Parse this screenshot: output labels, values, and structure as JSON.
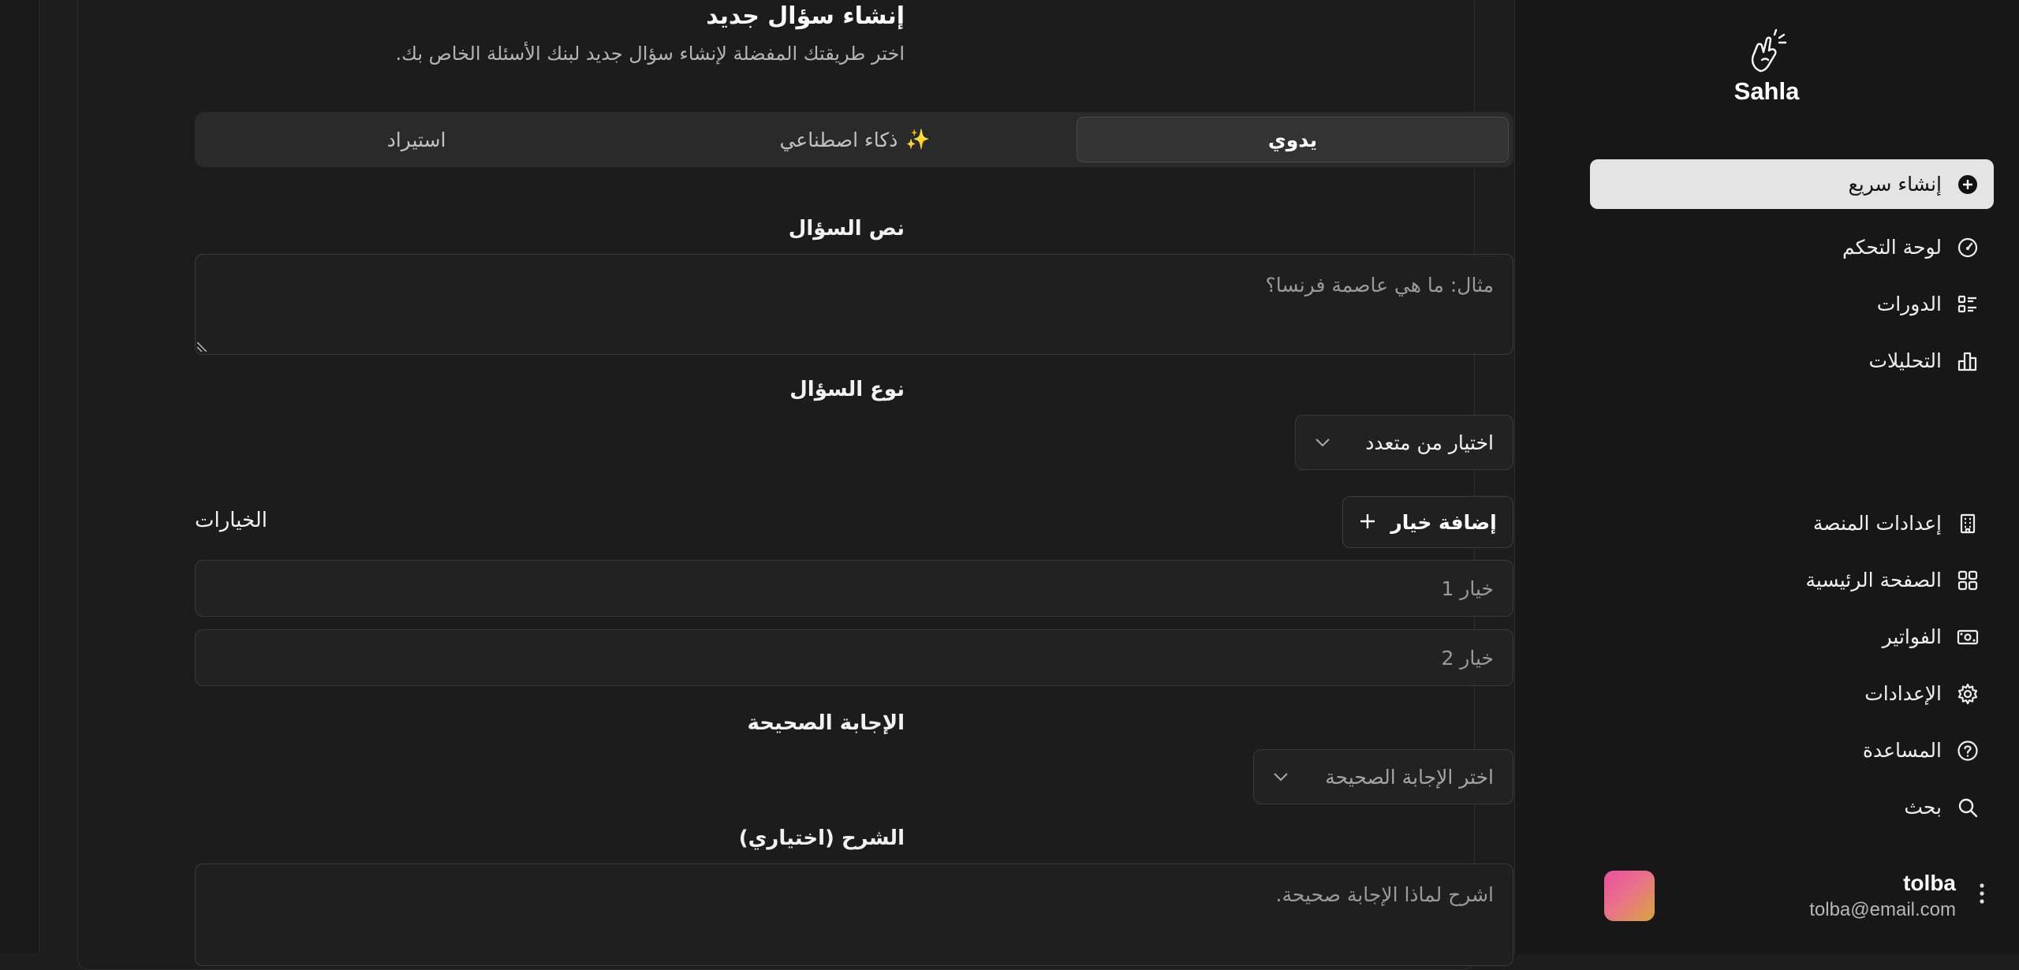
{
  "app": {
    "name": "Sahla"
  },
  "sidebar": {
    "items": [
      {
        "label": "إنشاء سريع",
        "icon": "plus-circle-icon",
        "active": true
      },
      {
        "label": "لوحة التحكم",
        "icon": "gauge-icon"
      },
      {
        "label": "الدورات",
        "icon": "list-icon"
      },
      {
        "label": "التحليلات",
        "icon": "bar-chart-icon"
      },
      {
        "label": "إعدادات المنصة",
        "icon": "building-icon"
      },
      {
        "label": "الصفحة الرئيسية",
        "icon": "grid-icon"
      },
      {
        "label": "الفواتير",
        "icon": "banknote-icon"
      },
      {
        "label": "الإعدادات",
        "icon": "gear-icon"
      },
      {
        "label": "المساعدة",
        "icon": "help-circle-icon"
      },
      {
        "label": "بحث",
        "icon": "search-icon"
      }
    ],
    "user": {
      "name": "tolba",
      "email": "tolba@email.com"
    }
  },
  "main": {
    "title": "إنشاء سؤال جديد",
    "subtitle": "اختر طريقتك المفضلة لإنشاء سؤال جديد لبنك الأسئلة الخاص بك.",
    "tabs": [
      {
        "label": "يدوي",
        "active": true
      },
      {
        "label": "ذكاء اصطناعي",
        "icon": "✨"
      },
      {
        "label": "استيراد"
      }
    ],
    "question_text": {
      "label": "نص السؤال",
      "placeholder": "مثال: ما هي عاصمة فرنسا؟"
    },
    "question_type": {
      "label": "نوع السؤال",
      "value": "اختيار من متعدد"
    },
    "options": {
      "label": "الخيارات",
      "add_button": "إضافة خيار",
      "items": [
        {
          "placeholder": "خيار 1"
        },
        {
          "placeholder": "خيار 2"
        }
      ]
    },
    "correct_answer": {
      "label": "الإجابة الصحيحة",
      "placeholder": "اختر الإجابة الصحيحة"
    },
    "explanation": {
      "label": "الشرح (اختياري)",
      "placeholder": "اشرح لماذا الإجابة صحيحة."
    }
  },
  "colors": {
    "accent": "#e4e4e4",
    "background": "#1c1c1c",
    "sidebar": "#171717"
  }
}
